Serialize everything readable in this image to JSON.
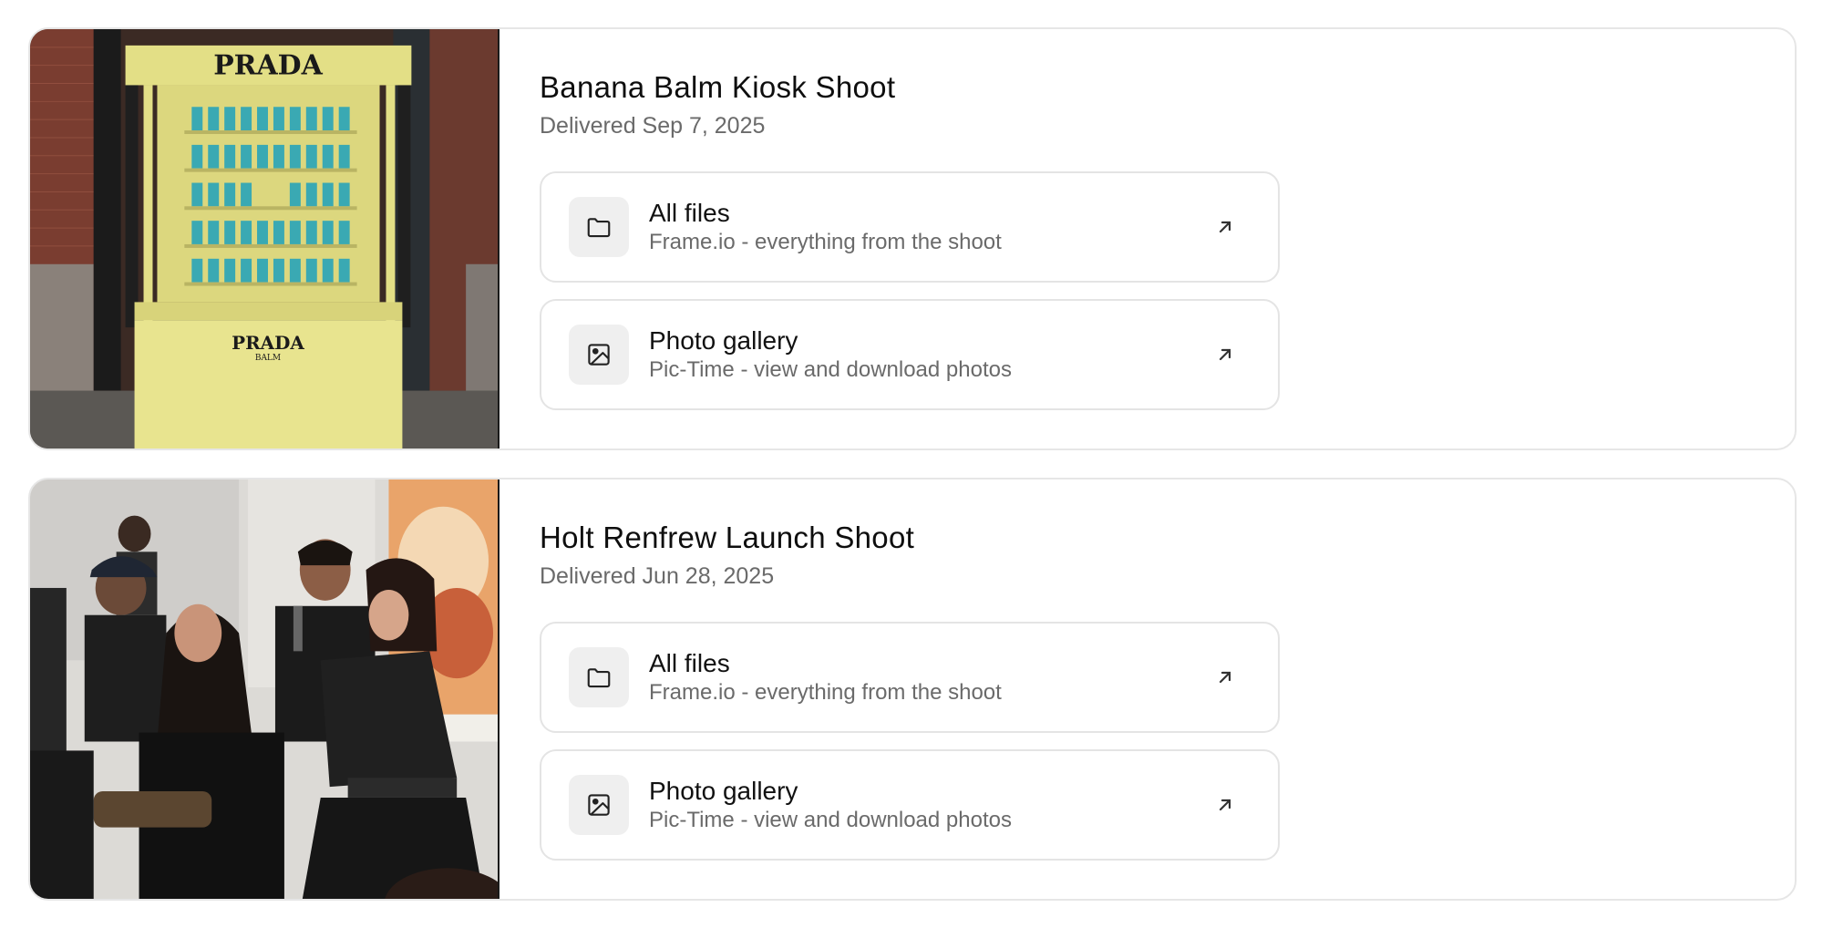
{
  "shoots": [
    {
      "title": "Banana Balm Kiosk Shoot",
      "date": "Delivered Sep 7, 2025",
      "thumbnail": {
        "sign_top": "PRADA",
        "sign_bottom": "PRADA",
        "sign_bottom_sub": "BALM"
      },
      "links": [
        {
          "title": "All files",
          "subtitle": "Frame.io - everything from the shoot",
          "icon": "folder-icon"
        },
        {
          "title": "Photo gallery",
          "subtitle": "Pic-Time - view and download photos",
          "icon": "image-icon"
        }
      ]
    },
    {
      "title": "Holt Renfrew Launch Shoot",
      "date": "Delivered Jun 28, 2025",
      "links": [
        {
          "title": "All files",
          "subtitle": "Frame.io - everything from the shoot",
          "icon": "folder-icon"
        },
        {
          "title": "Photo gallery",
          "subtitle": "Pic-Time - view and download photos",
          "icon": "image-icon"
        }
      ]
    }
  ],
  "colors": {
    "card_border": "#e6e6e6",
    "icon_bg": "#efefef",
    "muted_text": "#6a6a6a",
    "kiosk_yellow": "#e8e48f",
    "product_teal": "#3aa9b3"
  }
}
